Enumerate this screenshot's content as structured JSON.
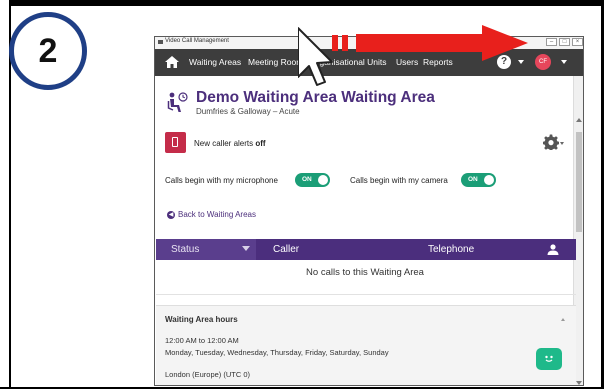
{
  "step": {
    "number": "2"
  },
  "window": {
    "title": "Video Call Management",
    "buttons": [
      "–",
      "□",
      "×"
    ]
  },
  "nav": {
    "items": [
      "Waiting Areas",
      "Meeting Rooms",
      "Organisational Units",
      "Users",
      "Reports"
    ],
    "help": "?",
    "avatar": "CF"
  },
  "waiting_area": {
    "title": "Demo Waiting Area Waiting Area",
    "subtitle": "Dumfries & Galloway – Acute"
  },
  "alerts": {
    "prefix": "New caller alerts",
    "state": "off"
  },
  "toggles": {
    "microphone": {
      "label": "Calls begin with my microphone",
      "state": "ON"
    },
    "camera": {
      "label": "Calls begin with my camera",
      "state": "ON"
    }
  },
  "back_link": "Back to Waiting Areas",
  "table": {
    "headers": [
      "Status",
      "Caller",
      "Telephone"
    ],
    "empty_message": "No calls to this Waiting Area"
  },
  "hours": {
    "title": "Waiting Area hours",
    "time": "12:00 AM to 12:00 AM",
    "days": "Monday, Tuesday, Wednesday, Thursday, Friday, Saturday, Sunday",
    "timezone": "London (Europe) (UTC 0)"
  },
  "colors": {
    "purple": "#4b2e7d",
    "nav_bg": "#3d3d3d",
    "toggle_green": "#1b9e77",
    "alert_red": "#c42c49",
    "arrow_red": "#e8201c",
    "step_ring": "#1f3f86"
  }
}
